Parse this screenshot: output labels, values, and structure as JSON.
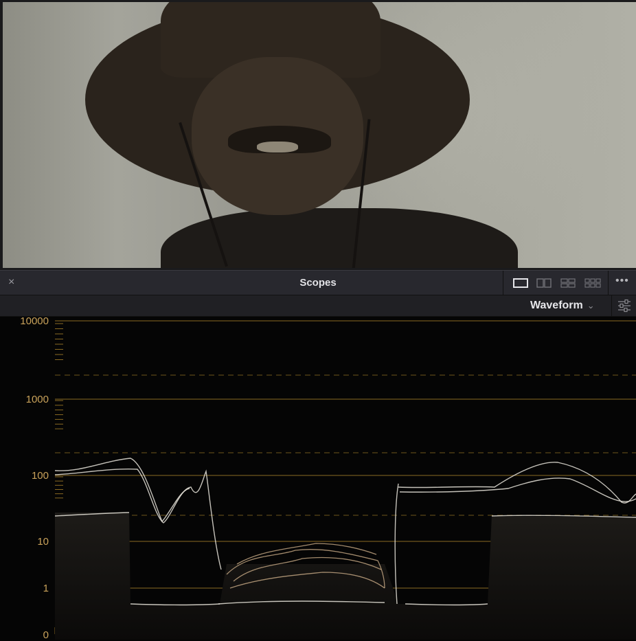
{
  "panel": {
    "title": "Scopes",
    "close_glyph": "×",
    "more_glyph": "•••"
  },
  "scope": {
    "selected_type": "Waveform",
    "chevron_glyph": "⌄",
    "scale_labels": [
      "10000",
      "1000",
      "100",
      "10",
      "1",
      "0"
    ],
    "colors": {
      "grid_line": "#8a6a22",
      "label": "#c9a25a",
      "trace": "#e8e4da",
      "warm_trace": "#d8b890"
    }
  },
  "layouts": [
    "single-layout-icon",
    "dual-layout-icon",
    "quad-layout-icon",
    "six-layout-icon"
  ]
}
